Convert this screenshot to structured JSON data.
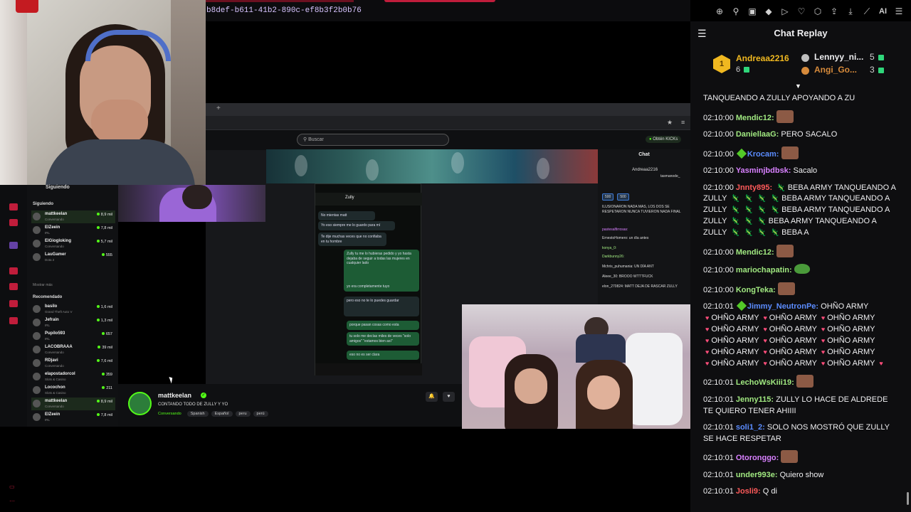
{
  "browser": {
    "url_fragment": "b8def-b611-41b2-890c-ef8b3f2b0b76",
    "ai_label": "AI",
    "toolbar_icons": [
      "zoom-in-icon",
      "pin-icon",
      "screenshot-icon",
      "shield-icon",
      "play-icon",
      "heart-icon",
      "extensions-icon",
      "share-icon",
      "download-icon",
      "wand-icon",
      "menu-icon"
    ]
  },
  "colors": {
    "kick_green": "#53fc18",
    "chat_bg": "#0e0e10",
    "accent_red": "#c01d3b",
    "gold": "#f0b820"
  },
  "capture": {
    "search_placeholder": "Buscar",
    "get_kicks": "Obtén KICKs",
    "sidebar": {
      "following_header": "Siguiendo",
      "following_section": "Siguiendo",
      "show_more": "Mostrar más",
      "recommended_section": "Recomendado",
      "following": [
        {
          "name": "mattkeelan",
          "sub": "Conversando",
          "viewers": "8,9 mil"
        },
        {
          "name": "ElZeein",
          "sub": "IRL",
          "viewers": "7,8 mil"
        },
        {
          "name": "ElGiogloking",
          "sub": "Conversando",
          "viewers": "5,7 mil"
        },
        {
          "name": "LauGamer",
          "sub": "Dota 2",
          "viewers": "555"
        }
      ],
      "recommended": [
        {
          "name": "basilo",
          "sub": "Grand Theft Auto V",
          "viewers": "1,6 mil"
        },
        {
          "name": "Jefrain",
          "sub": "IRL",
          "viewers": "1,3 mil"
        },
        {
          "name": "Pupilo593",
          "sub": "IRL",
          "viewers": "657"
        },
        {
          "name": "LACOBRAAA",
          "sub": "Conversando",
          "viewers": "39 mil"
        },
        {
          "name": "RDjavi",
          "sub": "Conversando",
          "viewers": "7,6 mil"
        },
        {
          "name": "elapostadorcol",
          "sub": "Slots & Casino",
          "viewers": "359"
        },
        {
          "name": "Locochon",
          "sub": "Slots & Casino",
          "viewers": "211"
        },
        {
          "name": "mattkeelan",
          "sub": "Conversando",
          "viewers": "8,9 mil"
        },
        {
          "name": "ElZeein",
          "sub": "IRL",
          "viewers": "7,8 mil"
        }
      ]
    },
    "phone": {
      "contact": "Zully",
      "messages": [
        {
          "dir": "in",
          "text": "No mientas matt"
        },
        {
          "dir": "in",
          "text": "Yo eso siempre me lo guardo para mí"
        },
        {
          "dir": "in",
          "text": "Te dije muchas veces que no confiaba en tu hombre"
        },
        {
          "dir": "out",
          "text": "Zully tu me lo hubieras pedido y yo hasta dejaba de seguir a todas las mujeres en cualquier lado"
        },
        {
          "dir": "out",
          "text": "yo era completamente tuyo"
        },
        {
          "dir": "in",
          "text": "pero eso no te lo puedes guardar"
        },
        {
          "dir": "out",
          "text": "porque pasan cosas como esta"
        },
        {
          "dir": "out",
          "text": "tu solo me decías miles de veces \"solo amigos\" \"estamos bien así\""
        },
        {
          "dir": "out",
          "text": "eso no es ser clara"
        }
      ]
    },
    "inner_chat": {
      "title": "Chat",
      "top_user": "Andreaa2216",
      "top_user2": "tasmanode_",
      "badges": [
        "500",
        "500"
      ],
      "lines": [
        "ILUSIONARON NADA MAS, LOS DOS SE RESPETARON NUNCA TUVIERON NADA FINAL",
        "pastesalfirrosas:",
        "ErnestoHomero: un día antes",
        "konya_0:",
        "Darkbunny26:",
        "Mchris_puhumania: UN DÍA ANT",
        "Aleee_30: BROOO WTTTFUCK",
        "elon_270824: MATT DEJA DE RASCAR ZULLY"
      ]
    },
    "streamer": {
      "name": "mattkeelan",
      "title": "CONTANDO TODO DE ZULLY Y YO",
      "category": "Conversando",
      "tags": [
        "Spanish",
        "Español",
        "peru",
        "perú"
      ]
    }
  },
  "chat_replay": {
    "title": "Chat Replay",
    "leaderboard": [
      {
        "rank": "1",
        "name": "Andreaa2216",
        "count": "6"
      },
      {
        "name": "Lennyy_ni...",
        "count": "5"
      },
      {
        "name": "Angi_Go...",
        "count": "3"
      }
    ],
    "messages": [
      {
        "time": "",
        "user": "",
        "color": "#efeff1",
        "parts": [
          {
            "t": "text",
            "v": "TANQUEANDO A ZULLY APOYANDO A ZU"
          }
        ]
      },
      {
        "time": "02:10:00",
        "user": "Mendic12:",
        "color": "#a0e880",
        "parts": [
          {
            "t": "emote",
            "v": "laughing-emote"
          }
        ]
      },
      {
        "time": "02:10:00",
        "user": "DaniellaaG:",
        "color": "#a0e880",
        "parts": [
          {
            "t": "text",
            "v": "PERO SACALO"
          }
        ]
      },
      {
        "time": "02:10:00",
        "user": "Krocam:",
        "color": "#5b8cff",
        "badge": true,
        "parts": [
          {
            "t": "emote",
            "v": "laughing-emote"
          }
        ]
      },
      {
        "time": "02:10:00",
        "user": "Yasminjbdbsk:",
        "color": "#d880ff",
        "parts": [
          {
            "t": "text",
            "v": "Sacalo"
          }
        ]
      },
      {
        "time": "02:10:00",
        "user": "Jnnty895:",
        "color": "#ff5a5a",
        "parts": [
          {
            "t": "lizard"
          },
          {
            "t": "text",
            "v": "BEBA ARMY TANQUEANDO A ZULLY"
          },
          {
            "t": "lizard"
          },
          {
            "t": "lizard"
          },
          {
            "t": "lizard"
          },
          {
            "t": "lizard"
          },
          {
            "t": "text",
            "v": "BEBA ARMY TANQUEANDO A ZULLY"
          },
          {
            "t": "lizard"
          },
          {
            "t": "lizard"
          },
          {
            "t": "lizard"
          },
          {
            "t": "lizard"
          },
          {
            "t": "text",
            "v": "BEBA ARMY TANQUEANDO A ZULLY"
          },
          {
            "t": "lizard"
          },
          {
            "t": "lizard"
          },
          {
            "t": "lizard"
          },
          {
            "t": "text",
            "v": "BEBA ARMY TANQUEANDO A ZULLY"
          },
          {
            "t": "lizard"
          },
          {
            "t": "lizard"
          },
          {
            "t": "lizard"
          },
          {
            "t": "lizard"
          },
          {
            "t": "text",
            "v": "BEBA A"
          }
        ]
      },
      {
        "time": "02:10:00",
        "user": "Mendic12:",
        "color": "#a0e880",
        "parts": [
          {
            "t": "emote",
            "v": "laughing-emote"
          }
        ]
      },
      {
        "time": "02:10:00",
        "user": "mariochapatin:",
        "color": "#a0e880",
        "parts": [
          {
            "t": "pepe",
            "v": "pepe-emote"
          }
        ]
      },
      {
        "time": "02:10:00",
        "user": "KongTeka:",
        "color": "#a0e880",
        "parts": [
          {
            "t": "emote",
            "v": "laughing-emote"
          }
        ]
      },
      {
        "time": "02:10:01",
        "user": "Jimmy_NeutronPe:",
        "color": "#5b8cff",
        "badge": true,
        "parts": [
          {
            "t": "text",
            "v": "OHÑO ARMY"
          },
          {
            "t": "heart"
          },
          {
            "t": "text",
            "v": "OHÑO ARMY"
          },
          {
            "t": "heart"
          },
          {
            "t": "text",
            "v": "OHÑO ARMY"
          },
          {
            "t": "heart"
          },
          {
            "t": "text",
            "v": "OHÑO ARMY"
          },
          {
            "t": "heart"
          },
          {
            "t": "text",
            "v": "OHÑO ARMY"
          },
          {
            "t": "heart"
          },
          {
            "t": "text",
            "v": "OHÑO ARMY"
          },
          {
            "t": "heart"
          },
          {
            "t": "text",
            "v": "OHÑO ARMY"
          },
          {
            "t": "heart"
          },
          {
            "t": "text",
            "v": "OHÑO ARMY"
          },
          {
            "t": "heart"
          },
          {
            "t": "text",
            "v": "OHÑO ARMY"
          },
          {
            "t": "heart"
          },
          {
            "t": "text",
            "v": "OHÑO ARMY"
          },
          {
            "t": "heart"
          },
          {
            "t": "text",
            "v": "OHÑO ARMY"
          },
          {
            "t": "heart"
          },
          {
            "t": "text",
            "v": "OHÑO ARMY"
          },
          {
            "t": "heart"
          },
          {
            "t": "text",
            "v": "OHÑO ARMY"
          },
          {
            "t": "heart"
          },
          {
            "t": "text",
            "v": "OHÑO ARMY"
          },
          {
            "t": "heart"
          },
          {
            "t": "text",
            "v": "OHÑO ARMY"
          },
          {
            "t": "heart"
          },
          {
            "t": "text",
            "v": "OHÑO ARMY"
          },
          {
            "t": "heart"
          }
        ]
      },
      {
        "time": "02:10:01",
        "user": "LechoWsKiii19:",
        "color": "#a0e880",
        "parts": [
          {
            "t": "emote",
            "v": "face-emote"
          }
        ]
      },
      {
        "time": "02:10:01",
        "user": "Jenny115:",
        "color": "#a0e880",
        "parts": [
          {
            "t": "text",
            "v": "ZULLY LO HACE DE ALDREDE TE QUIERO TENER AHIIII"
          }
        ]
      },
      {
        "time": "02:10:01",
        "user": "soli1_2:",
        "color": "#5b8cff",
        "parts": [
          {
            "t": "text",
            "v": "SOLO NOS MOSTRÓ QUE ZULLY SE HACE RESPETAR"
          }
        ]
      },
      {
        "time": "02:10:01",
        "user": "Otoronggo:",
        "color": "#d880ff",
        "parts": [
          {
            "t": "emote",
            "v": "laughing-emote"
          }
        ]
      },
      {
        "time": "02:10:01",
        "user": "under993e:",
        "color": "#a0e880",
        "parts": [
          {
            "t": "text",
            "v": "Quiero show"
          }
        ]
      },
      {
        "time": "02:10:01",
        "user": "Josli9:",
        "color": "#ff5a5a",
        "parts": [
          {
            "t": "text",
            "v": "Q di"
          }
        ]
      }
    ]
  }
}
